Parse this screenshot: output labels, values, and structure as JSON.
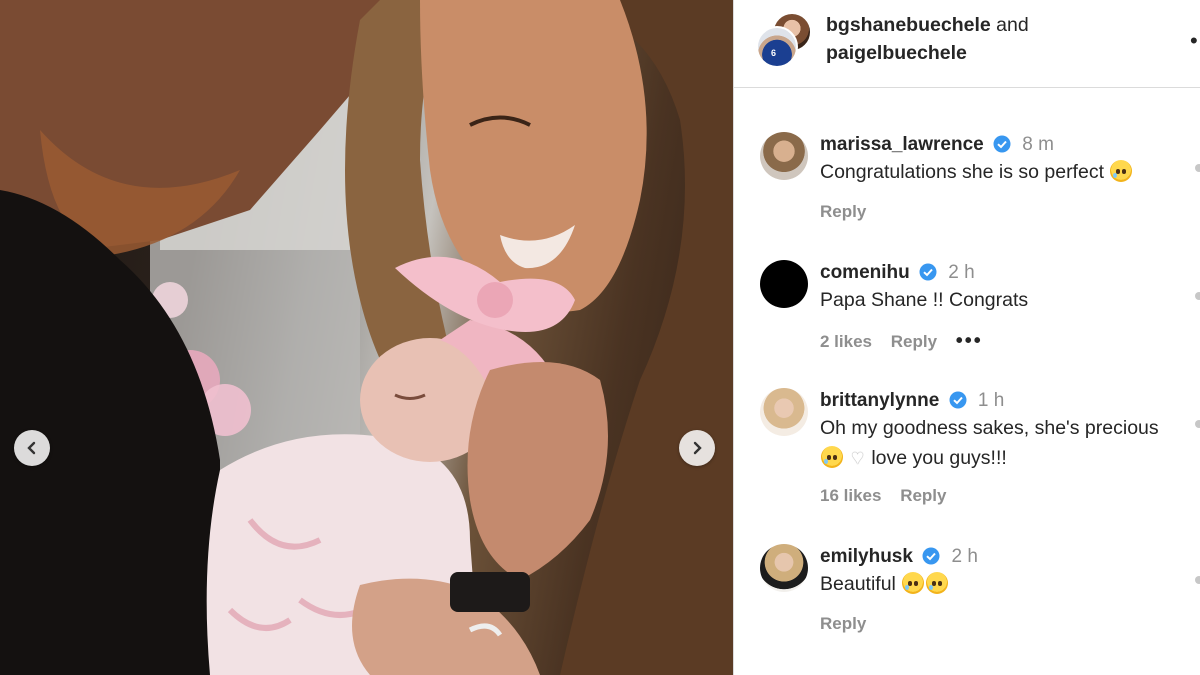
{
  "photo": {
    "prev_icon": "chevron-left-icon",
    "next_icon": "chevron-right-icon"
  },
  "header": {
    "user1": "bgshanebuechele",
    "and_text": "and",
    "user2": "paigelbuechele",
    "front_avatar_number": "6",
    "more_icon": "more-icon"
  },
  "comments": [
    {
      "username": "marissa_lawrence",
      "time": "8 m",
      "text": "Congratulations she is so perfect",
      "reply": "Reply",
      "verified": true
    },
    {
      "username": "comenihu",
      "time": "2 h",
      "text": "Papa Shane !! Congrats",
      "likes": "2 likes",
      "reply": "Reply",
      "more": "•••",
      "verified": true
    },
    {
      "username": "brittanylynne",
      "time": "1 h",
      "text_line1": "Oh my goodness sakes, she's precious",
      "text_line2": "love you guys!!!",
      "likes": "16 likes",
      "reply": "Reply",
      "verified": true
    },
    {
      "username": "emilyhusk",
      "time": "2 h",
      "text": "Beautiful",
      "reply": "Reply",
      "verified": true
    }
  ],
  "colors": {
    "verified": "#3897f0",
    "muted": "#8e8e8e",
    "text": "#262626",
    "divider": "#dbdbdb"
  }
}
